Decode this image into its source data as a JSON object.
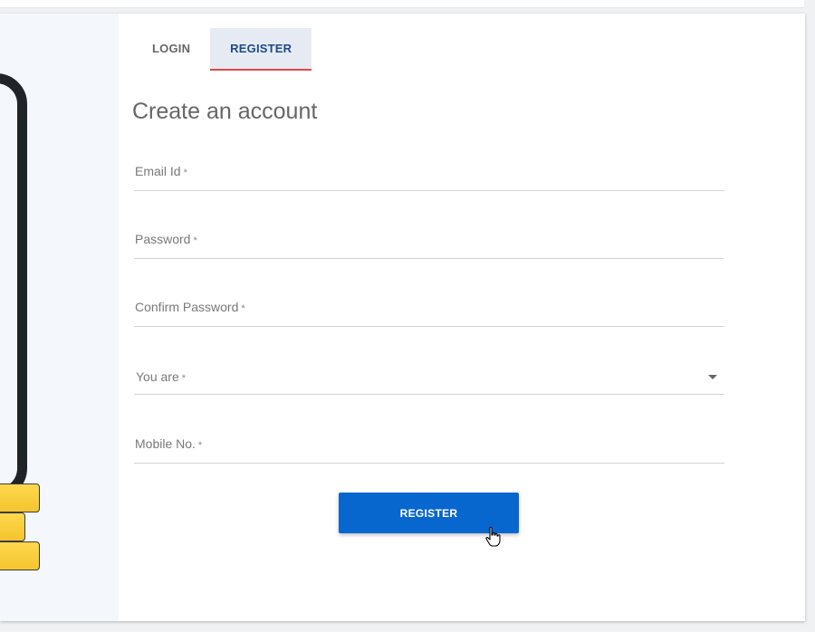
{
  "tabs": [
    {
      "label": "LOGIN",
      "active": false
    },
    {
      "label": "REGISTER",
      "active": true
    }
  ],
  "form": {
    "heading": "Create an account",
    "fields": [
      {
        "label": "Email Id",
        "required": "*",
        "value": ""
      },
      {
        "label": "Password",
        "required": "*",
        "value": ""
      },
      {
        "label": "Confirm Password",
        "required": "*",
        "value": ""
      },
      {
        "label": "You are",
        "required": "*",
        "value": "",
        "type": "select"
      },
      {
        "label": "Mobile No.",
        "required": "*",
        "value": ""
      }
    ],
    "submit_label": "REGISTER"
  },
  "colors": {
    "accent": "#0866cf",
    "active_tab_text": "#1d4a8a",
    "active_tab_bg": "#e6ebf3",
    "active_tab_indicator": "#e04a4a",
    "coin": "#f4c430"
  },
  "icons": {
    "dropdown": "caret-down-icon",
    "cursor": "hand-pointer-icon"
  }
}
